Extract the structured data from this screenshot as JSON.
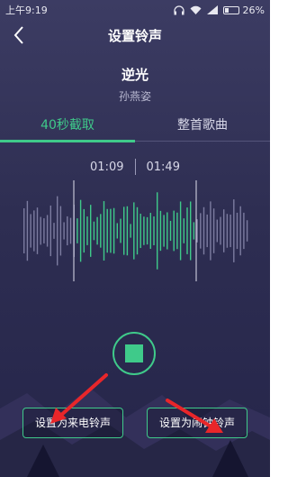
{
  "status": {
    "time": "上午9:19",
    "battery": "26%",
    "battery_level": 0.26
  },
  "header": {
    "title": "设置铃声",
    "back_icon": "chevron-left-icon"
  },
  "song": {
    "name": "逆光",
    "artist": "孙燕姿"
  },
  "tabs": [
    {
      "label": "40秒截取",
      "active": true
    },
    {
      "label": "整首歌曲",
      "active": false
    }
  ],
  "clip": {
    "start": "01:09",
    "end": "01:49"
  },
  "player": {
    "control_icon": "stop-icon"
  },
  "actions": {
    "call_ringtone": "设置为来电铃声",
    "alarm_ringtone": "设置为闹钟铃声"
  },
  "colors": {
    "accent": "#3fca8a",
    "annotation_arrow": "#e8262a",
    "background": "#2e2e52"
  }
}
